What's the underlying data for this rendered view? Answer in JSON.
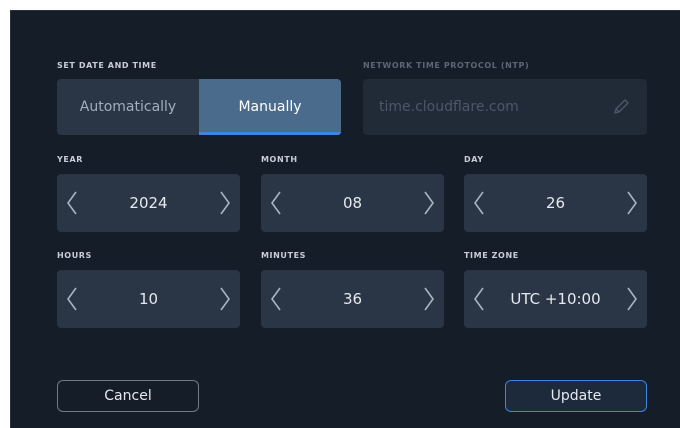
{
  "set_date": {
    "label": "SET DATE AND TIME",
    "options": [
      "Automatically",
      "Manually"
    ],
    "selected": "Manually"
  },
  "ntp": {
    "label": "NETWORK TIME PROTOCOL (NTP)",
    "value": "time.cloudflare.com",
    "icon": "pencil-icon"
  },
  "fields": {
    "year": {
      "label": "YEAR",
      "value": "2024"
    },
    "month": {
      "label": "MONTH",
      "value": "08"
    },
    "day": {
      "label": "DAY",
      "value": "26"
    },
    "hours": {
      "label": "HOURS",
      "value": "10"
    },
    "minutes": {
      "label": "MINUTES",
      "value": "36"
    },
    "timezone": {
      "label": "TIME ZONE",
      "value": "UTC +10:00"
    }
  },
  "buttons": {
    "cancel": "Cancel",
    "update": "Update"
  },
  "colors": {
    "background": "#151d28",
    "control": "#2a3545",
    "selected": "#4b6b8d",
    "accent": "#3b86e3"
  }
}
